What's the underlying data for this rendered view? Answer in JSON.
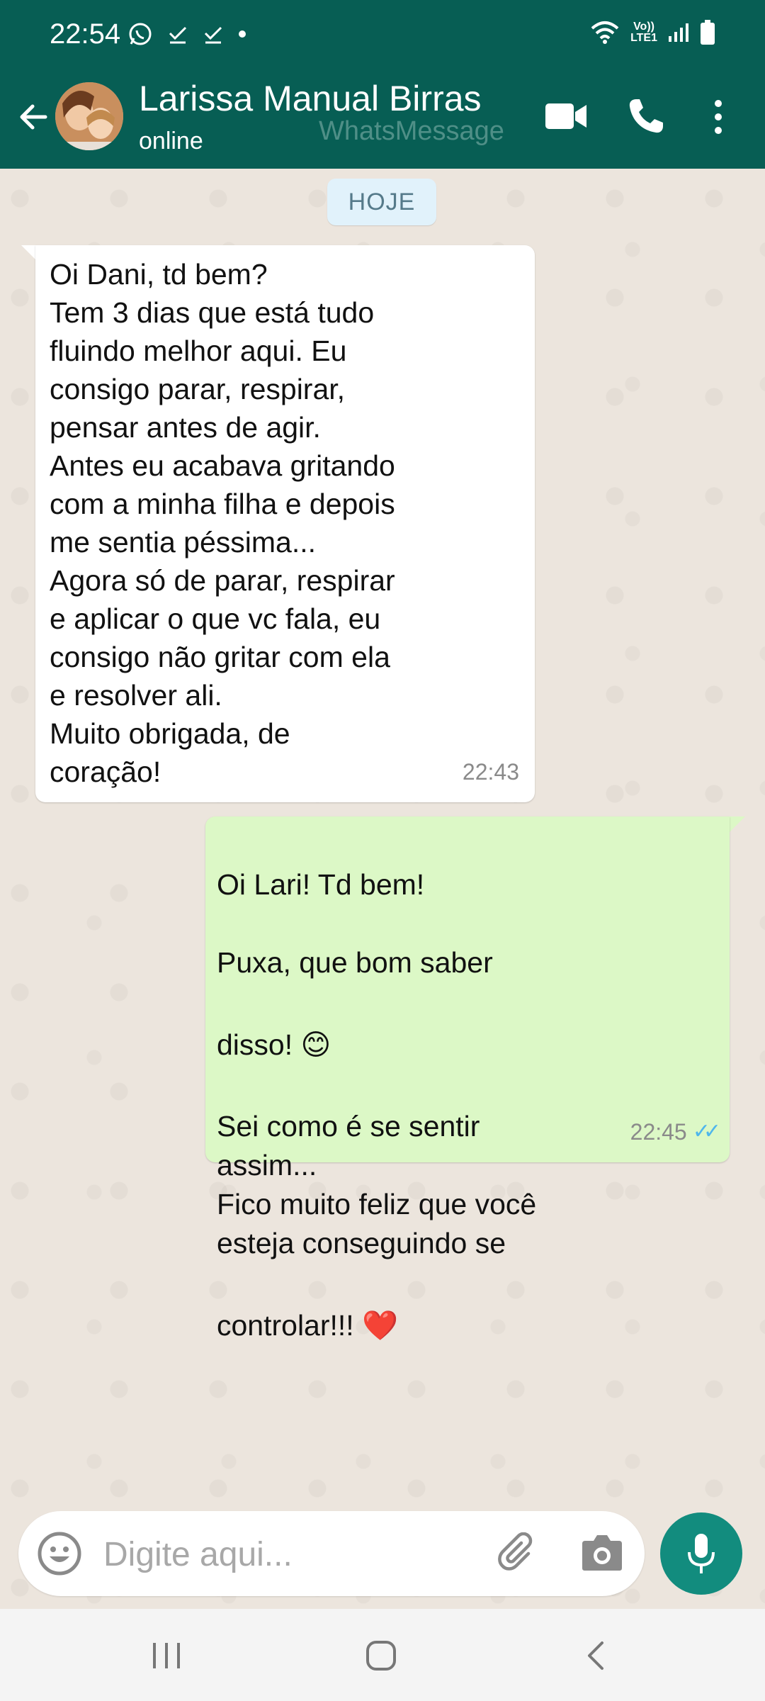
{
  "status_bar": {
    "time": "22:54",
    "lte_top": "Vo))",
    "lte_bottom": "LTE1"
  },
  "header": {
    "contact_name": "Larissa Manual Birras",
    "contact_status": "online",
    "watermark": "WhatsMessage"
  },
  "chat": {
    "date_label": "HOJE",
    "messages": [
      {
        "direction": "incoming",
        "text": "Oi Dani, td bem?\nTem 3 dias que está tudo\nfluindo melhor aqui. Eu\nconsigo parar, respirar,\npensar antes de agir.\nAntes eu acabava gritando\ncom a minha filha e depois\nme sentia péssima...\nAgora só de parar, respirar\ne aplicar o que vc fala, eu\nconsigo não gritar com ela\ne resolver ali.\nMuito obrigada, de\ncoração!",
        "time": "22:43"
      },
      {
        "direction": "outgoing",
        "line1": "Oi Lari! Td bem!",
        "line2": "Puxa, que bom saber",
        "line3": "disso! 😊",
        "line4": "Sei como é se sentir\nassim...\nFico muito feliz que você\nesteja conseguindo se",
        "line5": "controlar!!! ❤️",
        "time": "22:45",
        "read_ticks": "✓✓"
      }
    ]
  },
  "composer": {
    "placeholder": "Digite aqui..."
  },
  "colors": {
    "header": "#075e54",
    "incoming_bubble": "#ffffff",
    "outgoing_bubble": "#dcf8c6",
    "mic_button": "#128c7e",
    "read_tick": "#4fb6ec"
  },
  "icons": [
    "whatsapp-icon",
    "check-icon",
    "wifi-icon",
    "signal-icon",
    "battery-icon",
    "back-arrow-icon",
    "video-call-icon",
    "phone-icon",
    "more-options-icon",
    "emoji-icon",
    "attach-icon",
    "camera-icon",
    "mic-icon",
    "recent-apps-icon",
    "home-icon",
    "nav-back-icon"
  ]
}
